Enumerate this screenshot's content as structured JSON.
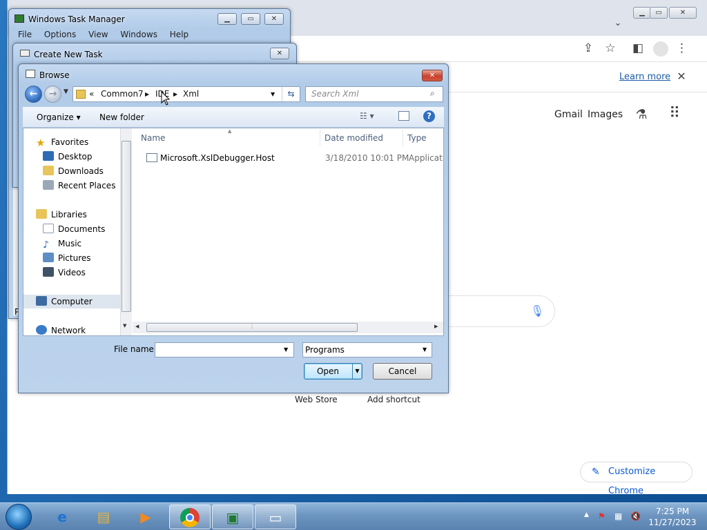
{
  "chrome": {
    "learn_more": "Learn more",
    "gmail": "Gmail",
    "images": "Images",
    "web_store": "Web Store",
    "add_shortcut": "Add shortcut",
    "customize": "Customize Chrome"
  },
  "task_manager": {
    "title": "Windows Task Manager",
    "menu": [
      "File",
      "Options",
      "View",
      "Windows",
      "Help"
    ],
    "partial_letter": "P"
  },
  "create_task": {
    "title": "Create New Task"
  },
  "browse": {
    "title": "Browse",
    "breadcrumb": {
      "chevrons": "«",
      "items": [
        "Common7",
        "IDE",
        "Xml"
      ]
    },
    "search_placeholder": "Search Xml",
    "organize": "Organize",
    "new_folder": "New folder",
    "nav": {
      "favorites": "Favorites",
      "favorites_items": [
        "Desktop",
        "Downloads",
        "Recent Places"
      ],
      "libraries": "Libraries",
      "libraries_items": [
        "Documents",
        "Music",
        "Pictures",
        "Videos"
      ],
      "computer": "Computer",
      "network": "Network"
    },
    "columns": [
      "Name",
      "Date modified",
      "Type"
    ],
    "files": [
      {
        "name": "Microsoft.XslDebugger.Host",
        "date": "3/18/2010 10:01 PM",
        "type": "Applicatio"
      }
    ],
    "file_name_label": "File name:",
    "file_name_value": "",
    "file_type": "Programs",
    "open": "Open",
    "cancel": "Cancel"
  },
  "taskbar": {
    "time": "7:25 PM",
    "date": "11/27/2023"
  },
  "colors": {
    "taskbar": "#6d95c0",
    "dialog_frame": "#b1cbe8",
    "close_red": "#c8412c",
    "chrome_link": "#1a5aa6",
    "customize_text": "#0b57d0"
  }
}
